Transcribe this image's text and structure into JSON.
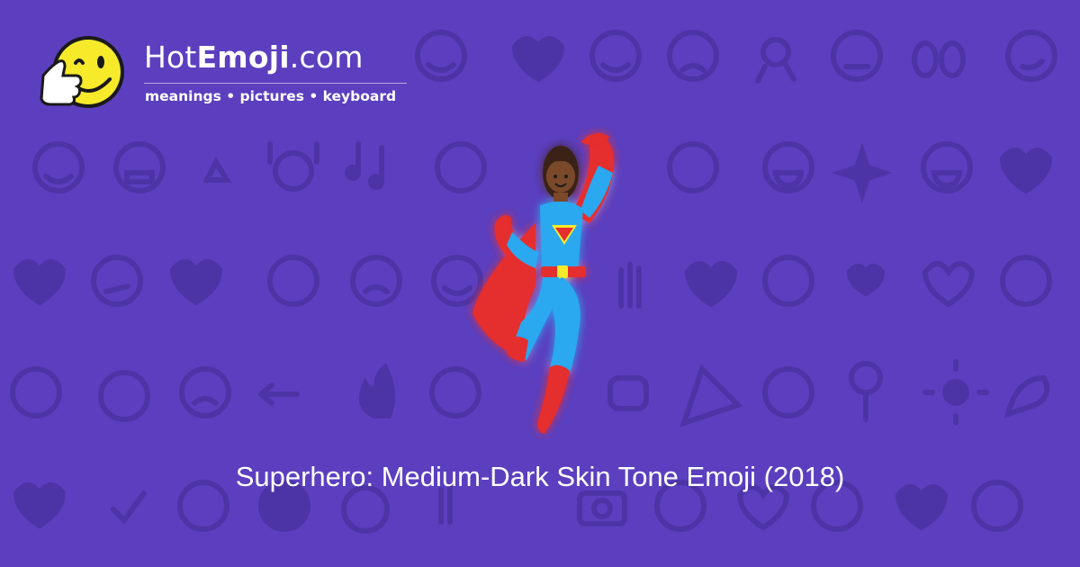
{
  "brand": {
    "prefix": "Hot",
    "bold": "Emoji",
    "suffix": ".com"
  },
  "tagline": "meanings • pictures • keyboard",
  "caption": "Superhero: Medium-Dark Skin Tone Emoji (2018)",
  "colors": {
    "background": "#5b3fbf",
    "pattern": "#4f36a8",
    "logo_face": "#f7ea2a",
    "cape": "#e52d2d",
    "suit": "#29a8f0",
    "skin": "#7a4a2a"
  },
  "hero_emoji": "superhero-medium-dark-skin-tone",
  "background_icons": [
    "smiley-face-icon",
    "heart-icon",
    "music-note-icon",
    "sparkles-icon",
    "monkey-icon",
    "fire-icon",
    "rose-icon",
    "sun-icon",
    "camera-icon",
    "arrow-left-icon",
    "check-icon",
    "flexed-biceps-icon"
  ]
}
